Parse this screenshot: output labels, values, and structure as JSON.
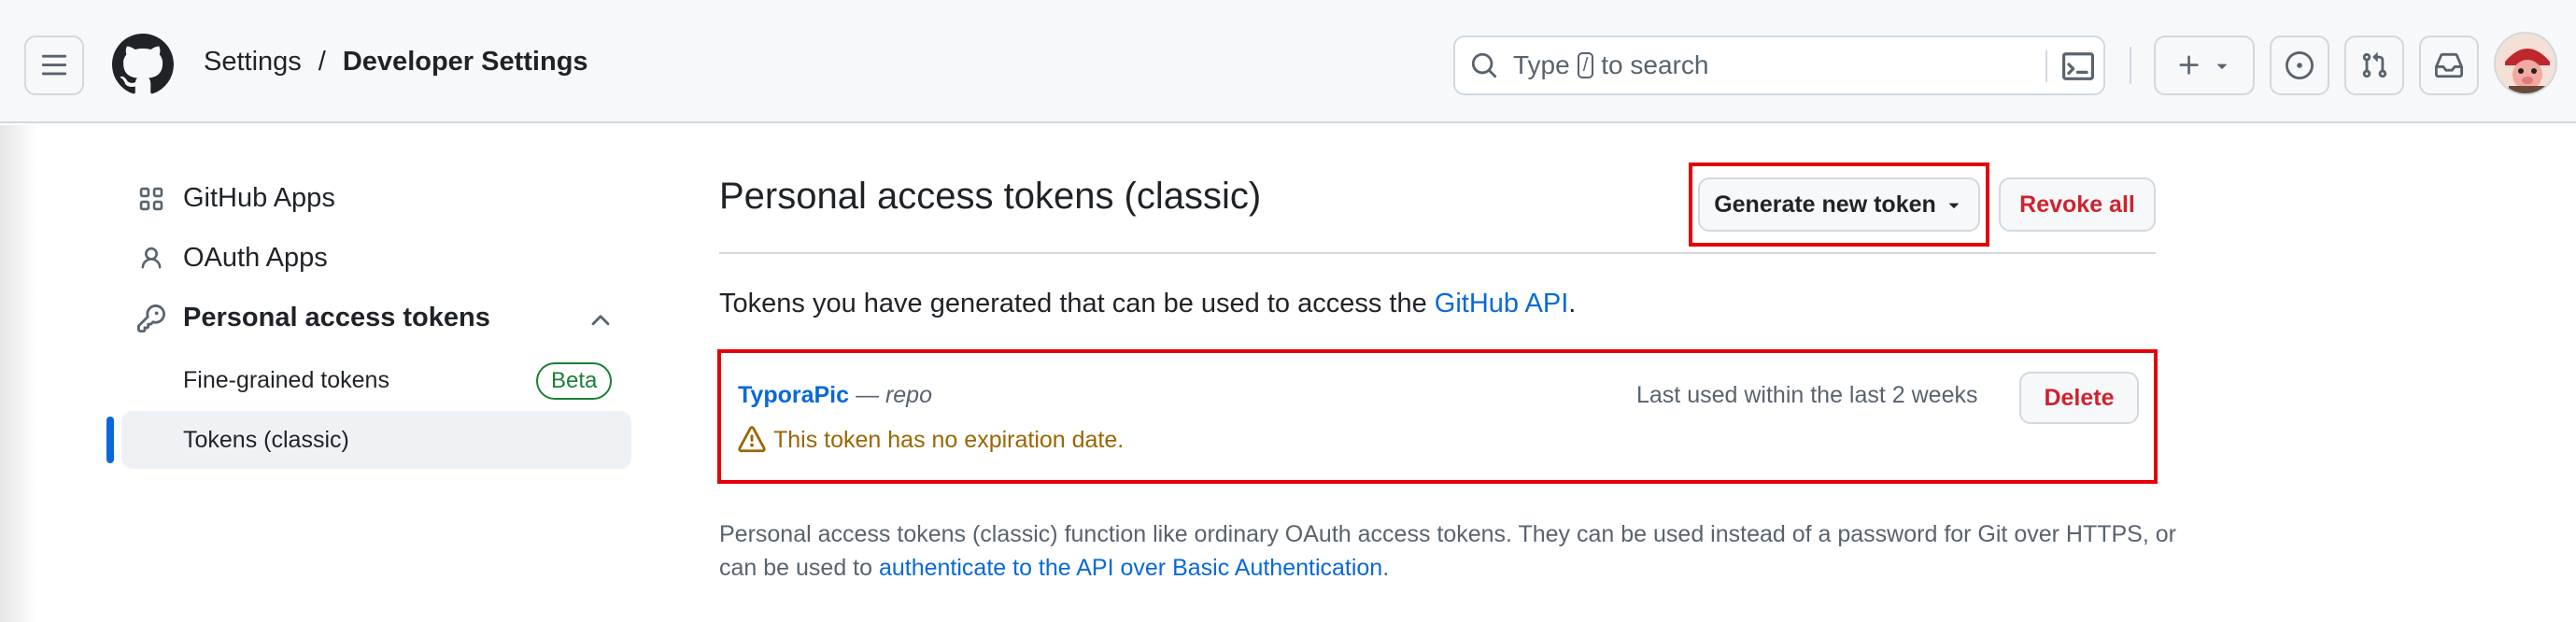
{
  "header": {
    "breadcrumb": [
      "Settings",
      "/",
      "Developer Settings"
    ],
    "search": {
      "prefix": "Type",
      "key": "/",
      "suffix": "to search"
    }
  },
  "sidebar": {
    "items": [
      {
        "label": "GitHub Apps",
        "icon": "apps-grid-icon"
      },
      {
        "label": "OAuth Apps",
        "icon": "person-icon"
      },
      {
        "label": "Personal access tokens",
        "icon": "key-icon",
        "expanded": true
      }
    ],
    "sub_items": [
      {
        "label": "Fine-grained tokens",
        "badge": "Beta"
      },
      {
        "label": "Tokens (classic)",
        "active": true
      }
    ]
  },
  "main": {
    "title": "Personal access tokens (classic)",
    "generate_button": "Generate new token",
    "revoke_all_button": "Revoke all",
    "intro_text": "Tokens you have generated that can be used to access the ",
    "intro_link": "GitHub API",
    "intro_end": ".",
    "token": {
      "name": "TyporaPic",
      "dash": " — ",
      "scope": "repo",
      "last_used": "Last used within the last 2 weeks",
      "delete_button": "Delete",
      "warning": "This token has no expiration date."
    },
    "footnote_text": "Personal access tokens (classic) function like ordinary OAuth access tokens. They can be used instead of a password for Git over HTTPS, or can be used to ",
    "footnote_link": "authenticate to the API over Basic Authentication",
    "footnote_end": "."
  },
  "colors": {
    "accent": "#0969da",
    "danger": "#cf222e",
    "success": "#1a7f37",
    "attention": "#9a6700",
    "highlight_box": "#e5000a"
  }
}
